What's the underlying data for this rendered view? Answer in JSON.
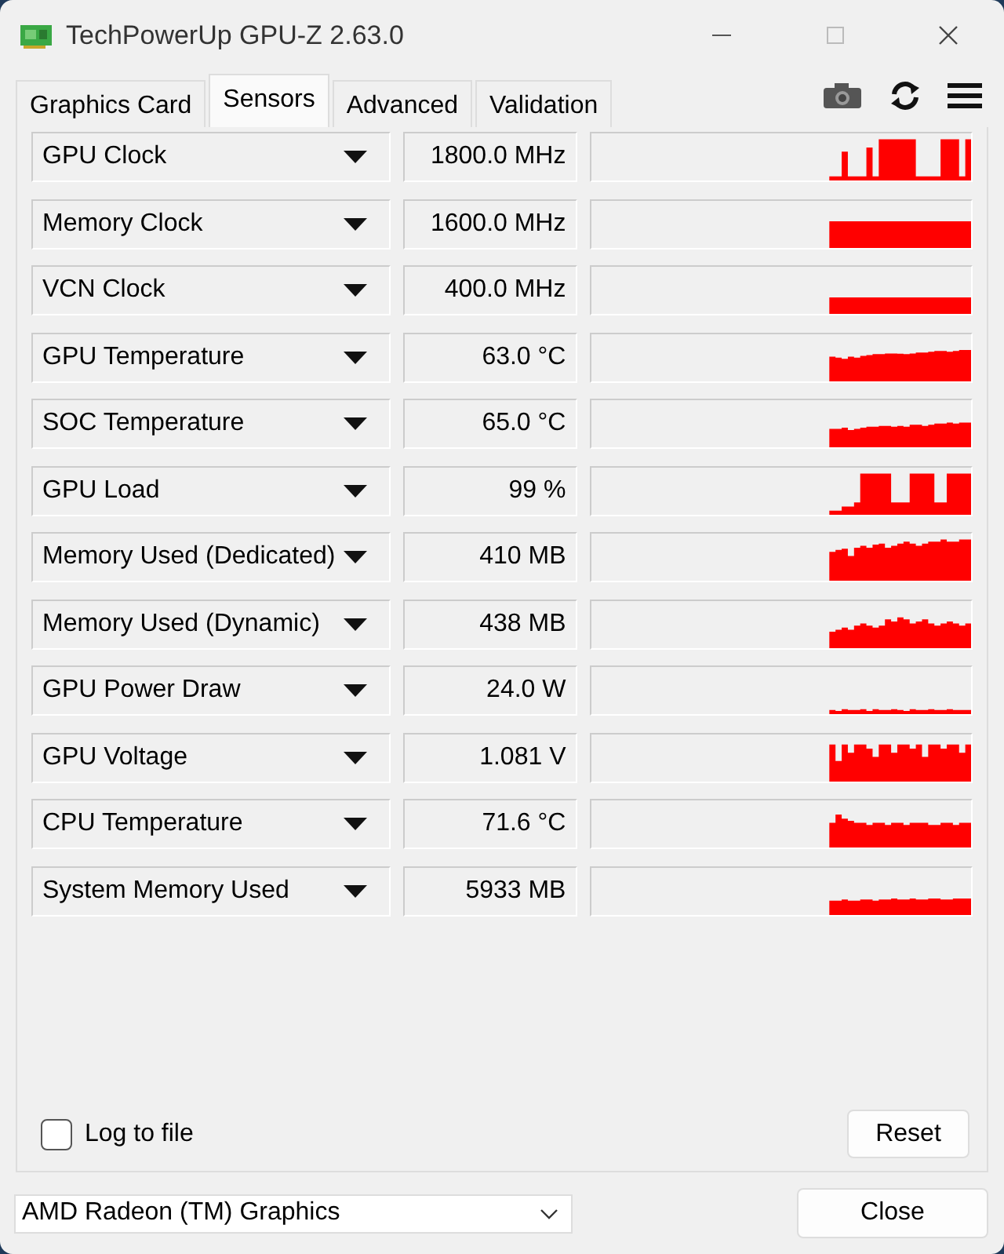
{
  "window": {
    "title": "TechPowerUp GPU-Z 2.63.0"
  },
  "tabs": [
    {
      "label": "Graphics Card",
      "selected": false
    },
    {
      "label": "Sensors",
      "selected": true
    },
    {
      "label": "Advanced",
      "selected": false
    },
    {
      "label": "Validation",
      "selected": false
    }
  ],
  "sensors": [
    {
      "name": "GPU Clock",
      "reading": "1800.0 MHz"
    },
    {
      "name": "Memory Clock",
      "reading": "1600.0 MHz"
    },
    {
      "name": "VCN Clock",
      "reading": "400.0 MHz"
    },
    {
      "name": "GPU Temperature",
      "reading": "63.0 °C"
    },
    {
      "name": "SOC Temperature",
      "reading": "65.0 °C"
    },
    {
      "name": "GPU Load",
      "reading": "99 %"
    },
    {
      "name": "Memory Used (Dedicated)",
      "reading": "410 MB"
    },
    {
      "name": "Memory Used (Dynamic)",
      "reading": "438 MB"
    },
    {
      "name": "GPU Power Draw",
      "reading": "24.0 W"
    },
    {
      "name": "GPU Voltage",
      "reading": "1.081 V"
    },
    {
      "name": "CPU Temperature",
      "reading": "71.6 °C"
    },
    {
      "name": "System Memory Used",
      "reading": "5933 MB"
    }
  ],
  "log_to_file": {
    "label": "Log to file",
    "checked": false
  },
  "reset_button": "Reset",
  "device_select": {
    "value": "AMD Radeon (TM) Graphics"
  },
  "close_button": "Close"
}
